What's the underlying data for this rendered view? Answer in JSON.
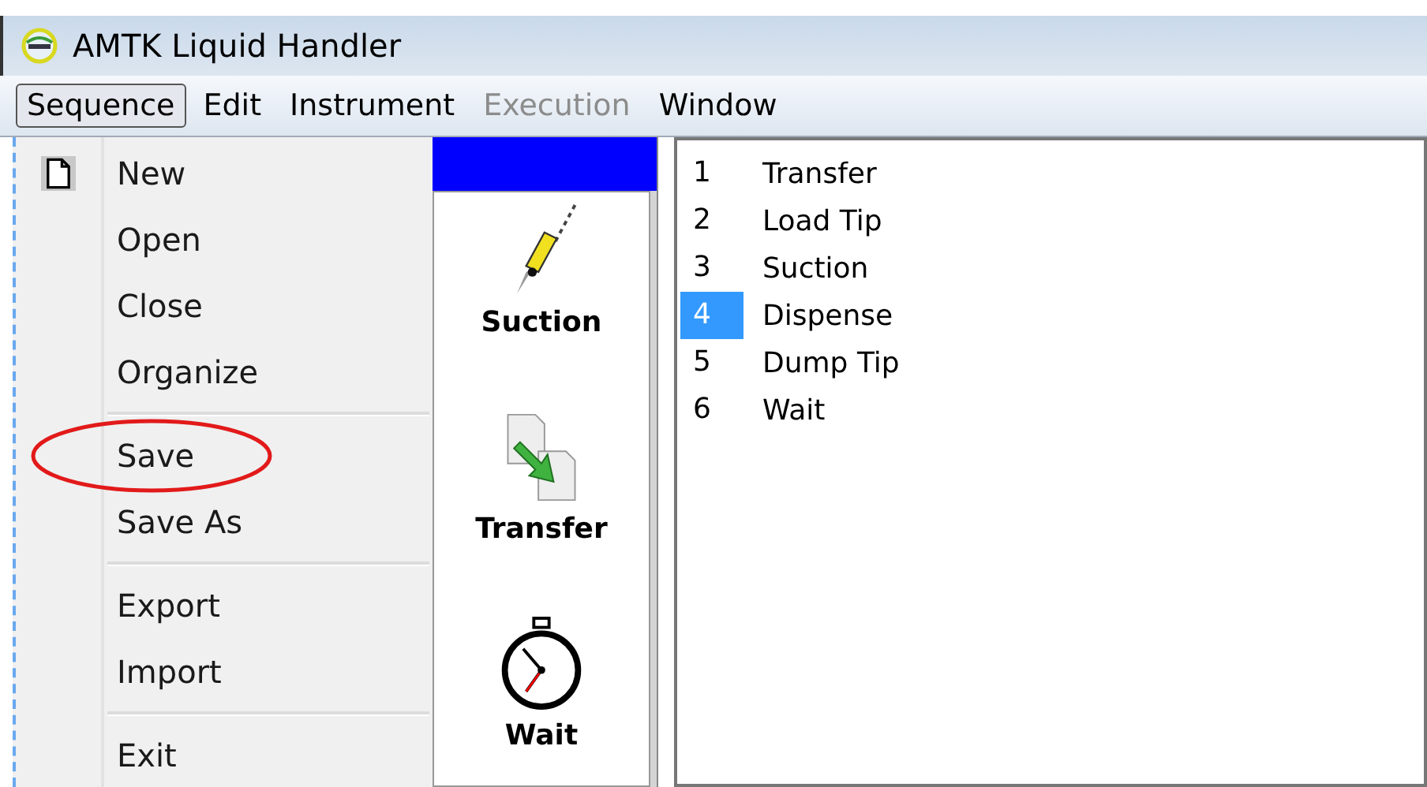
{
  "window": {
    "title": "AMTK Liquid Handler"
  },
  "menubar": [
    {
      "label": "Sequence",
      "selected": true,
      "disabled": false
    },
    {
      "label": "Edit",
      "selected": false,
      "disabled": false
    },
    {
      "label": "Instrument",
      "selected": false,
      "disabled": false
    },
    {
      "label": "Execution",
      "selected": false,
      "disabled": true
    },
    {
      "label": "Window",
      "selected": false,
      "disabled": false
    }
  ],
  "menu_groups": [
    [
      {
        "label": "New",
        "kind": "new",
        "circled": false
      },
      {
        "label": "Open",
        "kind": "plain",
        "circled": false
      },
      {
        "label": "Close",
        "kind": "plain",
        "circled": false
      },
      {
        "label": "Organize",
        "kind": "plain",
        "circled": false
      }
    ],
    [
      {
        "label": "Save",
        "kind": "plain",
        "circled": true
      },
      {
        "label": "Save As",
        "kind": "plain",
        "circled": false
      }
    ],
    [
      {
        "label": "Export",
        "kind": "plain",
        "circled": false
      },
      {
        "label": "Import",
        "kind": "plain",
        "circled": false
      }
    ],
    [
      {
        "label": "Exit",
        "kind": "plain",
        "circled": false
      }
    ]
  ],
  "toolbox": [
    {
      "label": "Suction",
      "kind": "pipette"
    },
    {
      "label": "Transfer",
      "kind": "transfer"
    },
    {
      "label": "Wait",
      "kind": "stopwatch"
    }
  ],
  "steps": [
    {
      "number": "1",
      "name": "Transfer",
      "selected": false
    },
    {
      "number": "2",
      "name": "Load Tip",
      "selected": false
    },
    {
      "number": "3",
      "name": "Suction",
      "selected": false
    },
    {
      "number": "4",
      "name": "Dispense",
      "selected": true
    },
    {
      "number": "5",
      "name": "Dump Tip",
      "selected": false
    },
    {
      "number": "6",
      "name": "Wait",
      "selected": false
    }
  ]
}
